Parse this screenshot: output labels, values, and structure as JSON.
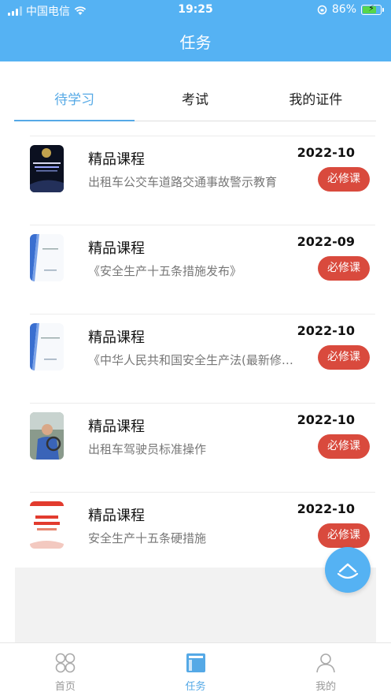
{
  "status_bar": {
    "carrier": "中国电信",
    "time": "19:25",
    "battery_percent": "86%",
    "battery_level": 0.86
  },
  "header": {
    "title": "任务"
  },
  "tabs": [
    {
      "label": "待学习",
      "active": true
    },
    {
      "label": "考试",
      "active": false
    },
    {
      "label": "我的证件",
      "active": false
    }
  ],
  "courses": [
    {
      "title": "精品课程",
      "date": "2022-10",
      "description": "出租车公交车道路交通事故警示教育",
      "badge": "必修课",
      "thumb_icon": "dark-poster-thumbnail"
    },
    {
      "title": "精品课程",
      "date": "2022-09",
      "description": "《安全生产十五条措施发布》",
      "badge": "必修课",
      "thumb_icon": "document-cover-thumbnail"
    },
    {
      "title": "精品课程",
      "date": "2022-10",
      "description": "《中华人民共和国安全生产法(最新修订)》",
      "badge": "必修课",
      "thumb_icon": "document-cover-thumbnail"
    },
    {
      "title": "精品课程",
      "date": "2022-10",
      "description": "出租车驾驶员标准操作",
      "badge": "必修课",
      "thumb_icon": "driver-photo-thumbnail"
    },
    {
      "title": "精品课程",
      "date": "2022-10",
      "description": "安全生产十五条硬措施",
      "badge": "必修课",
      "thumb_icon": "red-text-poster-thumbnail"
    }
  ],
  "bottom_nav": [
    {
      "label": "首页",
      "icon": "home-grid-icon",
      "active": false
    },
    {
      "label": "任务",
      "icon": "task-list-icon",
      "active": true
    },
    {
      "label": "我的",
      "icon": "profile-icon",
      "active": false
    }
  ],
  "colors": {
    "primary": "#55b2f3",
    "tab_active": "#55a9e6",
    "badge": "#d94a3d",
    "inactive": "#999999"
  }
}
